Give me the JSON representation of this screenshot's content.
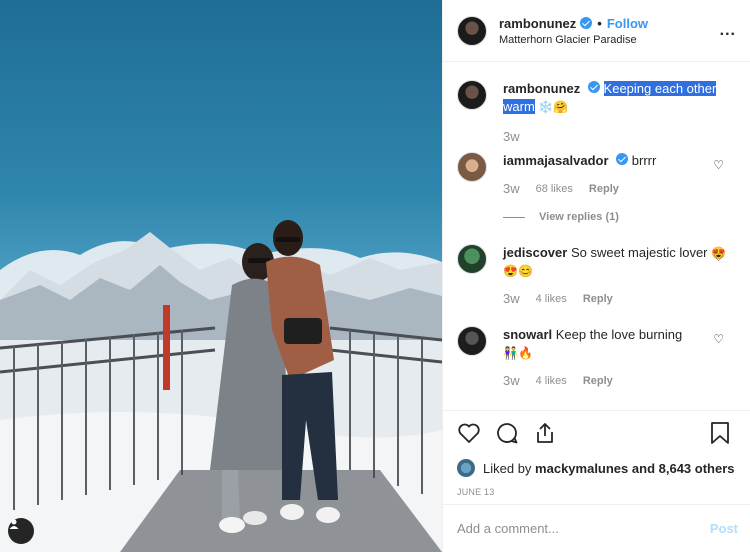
{
  "header": {
    "username": "rambonunez",
    "separator": "•",
    "follow_label": "Follow",
    "location": "Matterhorn Glacier Paradise",
    "more_label": "..."
  },
  "caption": {
    "username": "rambonunez",
    "text_selected_1": "Keeping each other",
    "text_selected_2": "warm",
    "emojis": "❄️🤗",
    "age": "3w"
  },
  "comments": [
    {
      "username": "iammajasalvador",
      "verified": true,
      "text": "brrrr",
      "age": "3w",
      "likes": "68 likes",
      "reply_label": "Reply",
      "view_replies": "View replies (1)",
      "avatar_color": "#7a5a44"
    },
    {
      "username": "jediscover",
      "verified": false,
      "text": "So sweet majestic lover",
      "emojis": "😍😍😊",
      "age": "3w",
      "likes": "4 likes",
      "reply_label": "Reply",
      "avatar_color": "#2e6a3a"
    },
    {
      "username": "snowarl",
      "verified": false,
      "text": "Keep the love burning",
      "emojis": "👫🔥",
      "age": "3w",
      "likes": "4 likes",
      "reply_label": "Reply",
      "avatar_color": "#2a2a2a"
    }
  ],
  "liked_by": {
    "prefix": "Liked by",
    "user": "mackymalunes",
    "suffix": "and 8,643 others"
  },
  "date": "JUNE 13",
  "add_comment": {
    "placeholder": "Add a comment...",
    "post_label": "Post"
  },
  "colors": {
    "accent": "#3897f0",
    "selection": "#2f6fe0",
    "muted": "#8e8e8e"
  },
  "icons": [
    "heart-icon",
    "comment-icon",
    "share-icon",
    "bookmark-icon",
    "user-tag-icon",
    "verified-icon"
  ]
}
